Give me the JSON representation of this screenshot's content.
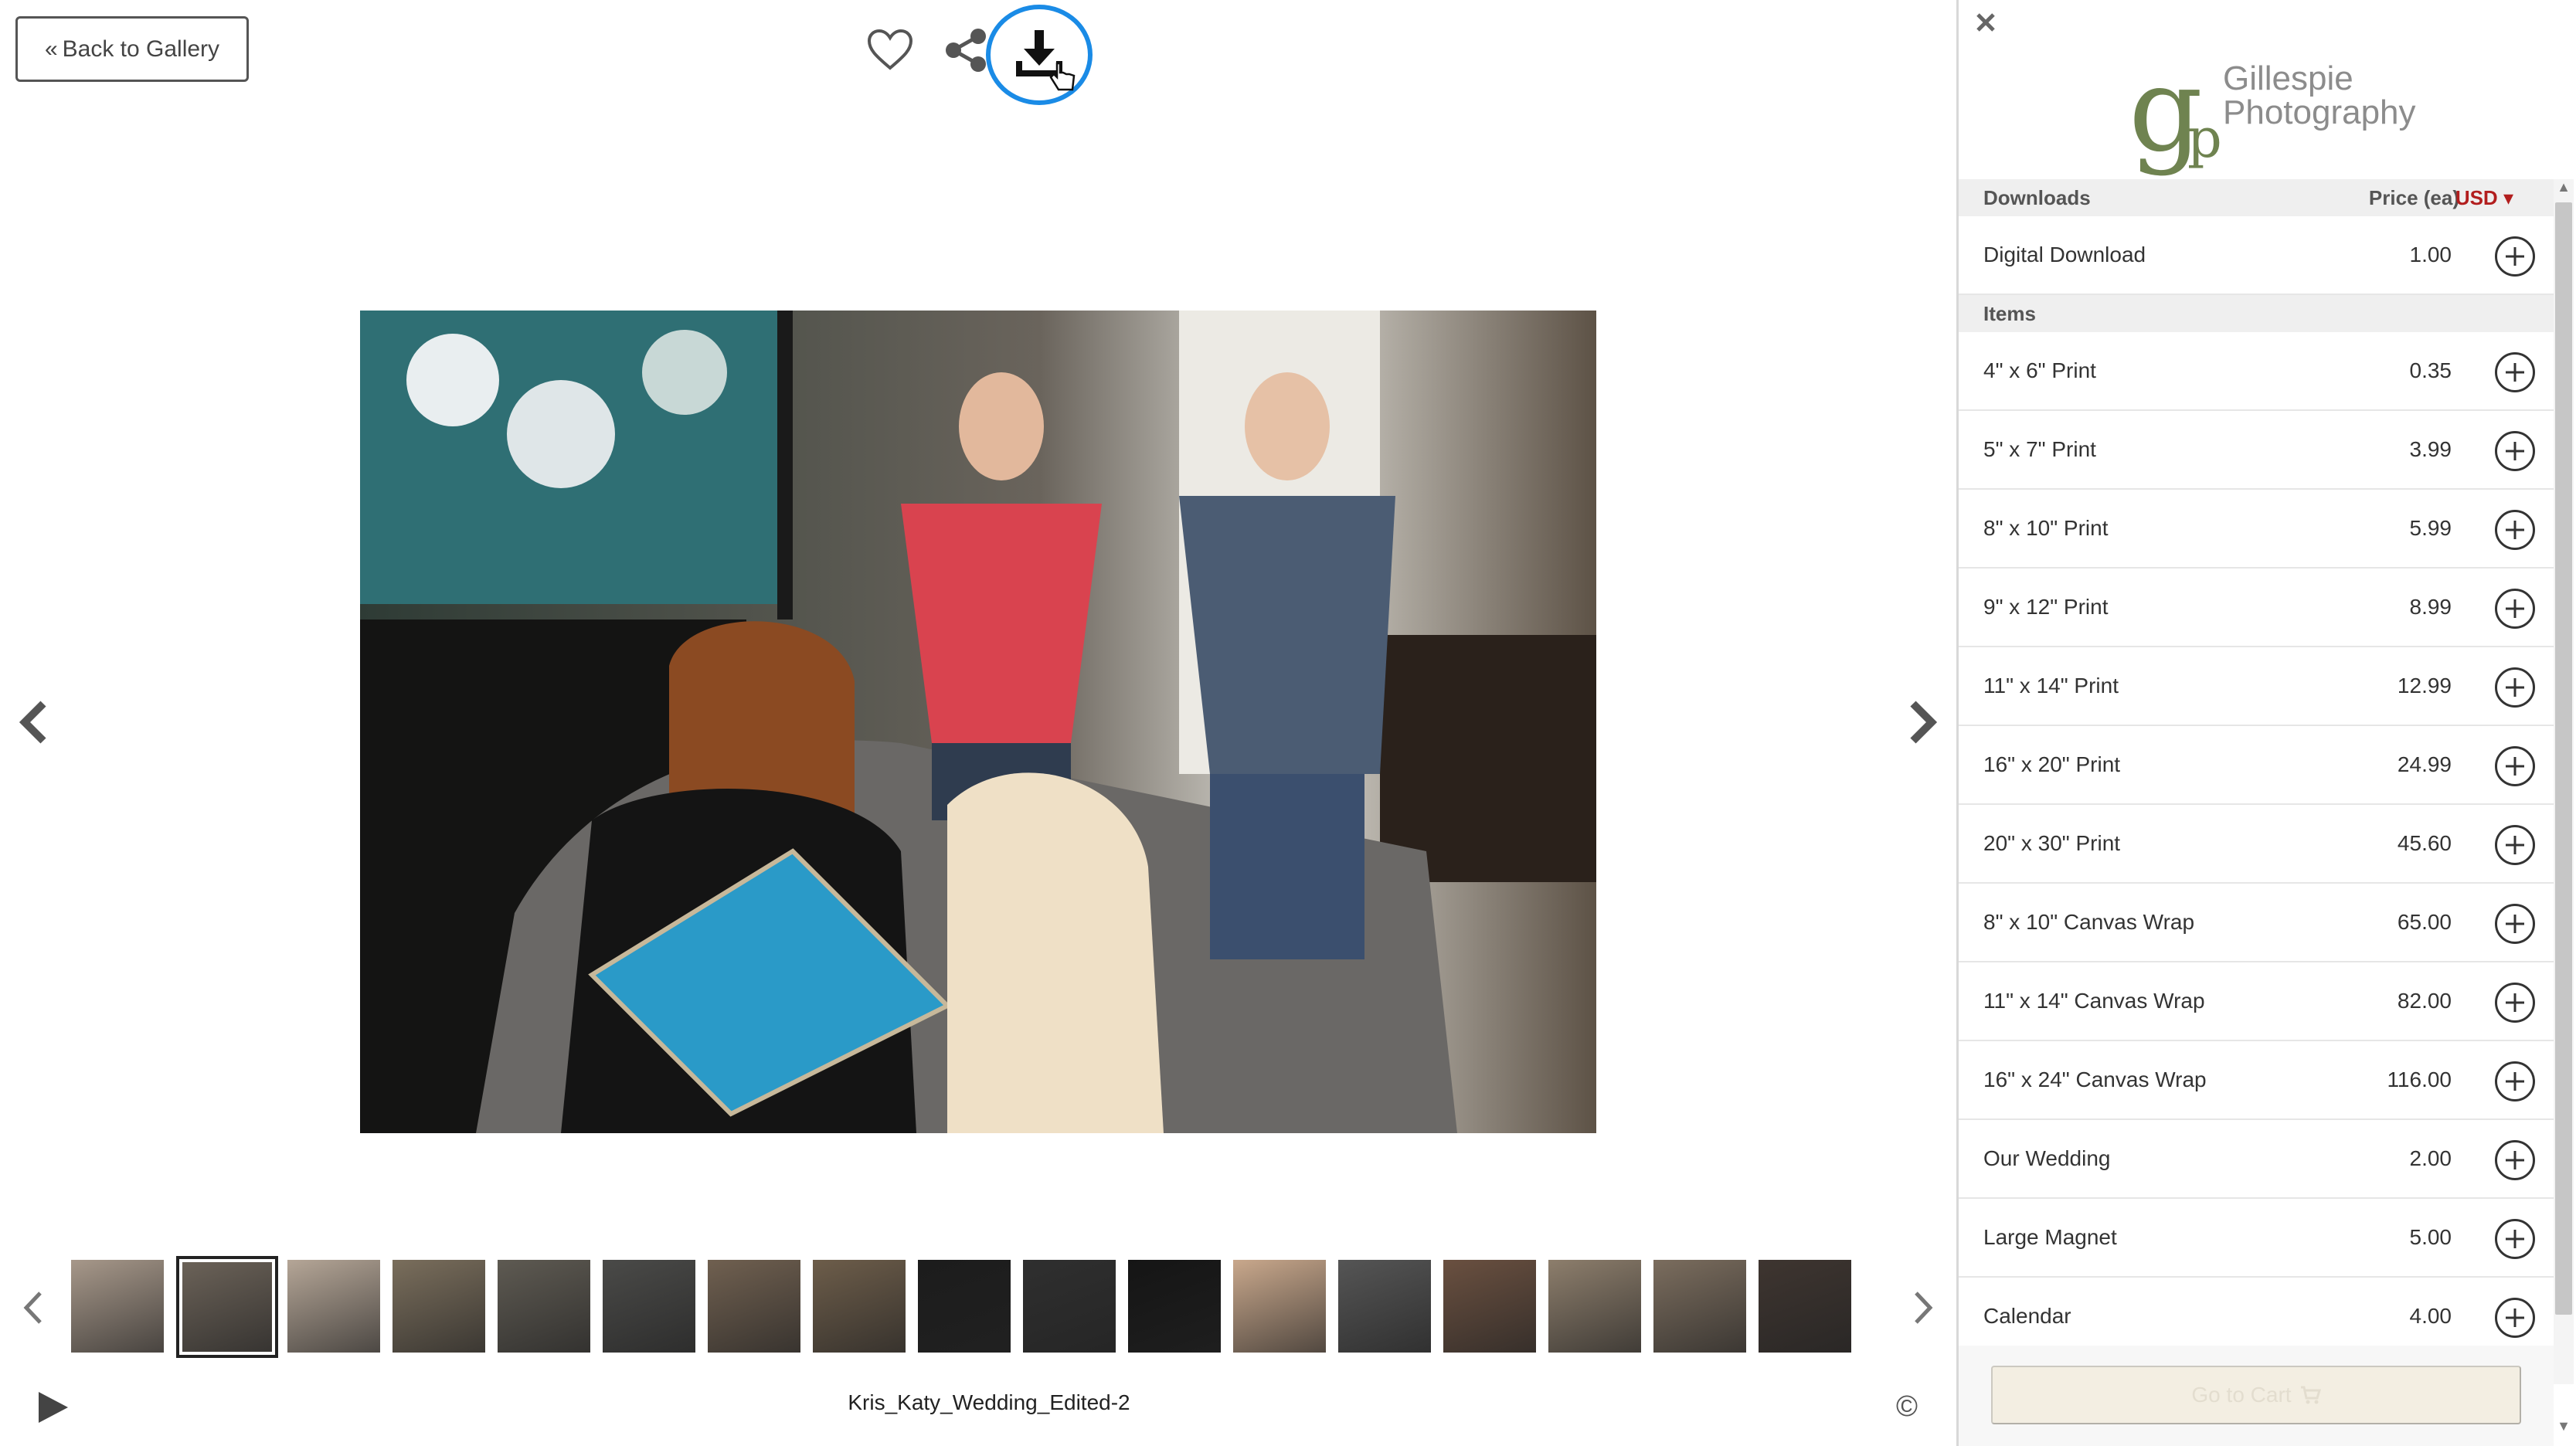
{
  "viewer": {
    "back_label": "Back to Gallery",
    "caption": "Kris_Katy_Wedding_Edited-2",
    "copyright_symbol": "©",
    "icons": [
      "heart-icon",
      "share-icon",
      "download-icon",
      "chevron-left-icon",
      "chevron-right-icon",
      "play-icon"
    ],
    "download_highlight_color": "#1a8be6",
    "thumbnails": [
      {
        "tone": "#a7988a",
        "selected": false
      },
      {
        "tone": "#6b6258",
        "selected": true
      },
      {
        "tone": "#b5a697",
        "selected": false
      },
      {
        "tone": "#7a6e5c",
        "selected": false
      },
      {
        "tone": "#5e5a52",
        "selected": false
      },
      {
        "tone": "#4a4a48",
        "selected": false
      },
      {
        "tone": "#706050",
        "selected": false
      },
      {
        "tone": "#6d5d4a",
        "selected": false
      },
      {
        "tone": "#1c1c1c",
        "selected": false
      },
      {
        "tone": "#2f2f2f",
        "selected": false
      },
      {
        "tone": "#151515",
        "selected": false
      },
      {
        "tone": "#c9a88c",
        "selected": false
      },
      {
        "tone": "#555555",
        "selected": false
      },
      {
        "tone": "#6a5040",
        "selected": false
      },
      {
        "tone": "#8d7e6c",
        "selected": false
      },
      {
        "tone": "#7b6d5e",
        "selected": false
      },
      {
        "tone": "#3e3530",
        "selected": false
      }
    ]
  },
  "panel": {
    "logo_mark": "g",
    "logo_mark_p": "p",
    "logo_line1": "Gillespie",
    "logo_line2": "Photography",
    "brand_color": "#6f8350",
    "downloads_header": "Downloads",
    "price_header": "Price (ea)",
    "currency": "USD",
    "downloads": [
      {
        "name": "Digital Download",
        "price": "1.00"
      }
    ],
    "items_header": "Items",
    "items": [
      {
        "name": "4\" x 6\" Print",
        "price": "0.35"
      },
      {
        "name": "5\" x 7\" Print",
        "price": "3.99"
      },
      {
        "name": "8\" x 10\" Print",
        "price": "5.99"
      },
      {
        "name": "9\" x 12\" Print",
        "price": "8.99"
      },
      {
        "name": "11\" x 14\" Print",
        "price": "12.99"
      },
      {
        "name": "16\" x 20\" Print",
        "price": "24.99"
      },
      {
        "name": "20\" x 30\" Print",
        "price": "45.60"
      },
      {
        "name": "8\" x 10\" Canvas Wrap",
        "price": "65.00"
      },
      {
        "name": "11\" x 14\" Canvas Wrap",
        "price": "82.00"
      },
      {
        "name": "16\" x 24\" Canvas Wrap",
        "price": "116.00"
      },
      {
        "name": "Our Wedding",
        "price": "2.00"
      },
      {
        "name": "Large Magnet",
        "price": "5.00"
      },
      {
        "name": "Calendar",
        "price": "4.00"
      }
    ],
    "cart_label": "Go to Cart"
  }
}
